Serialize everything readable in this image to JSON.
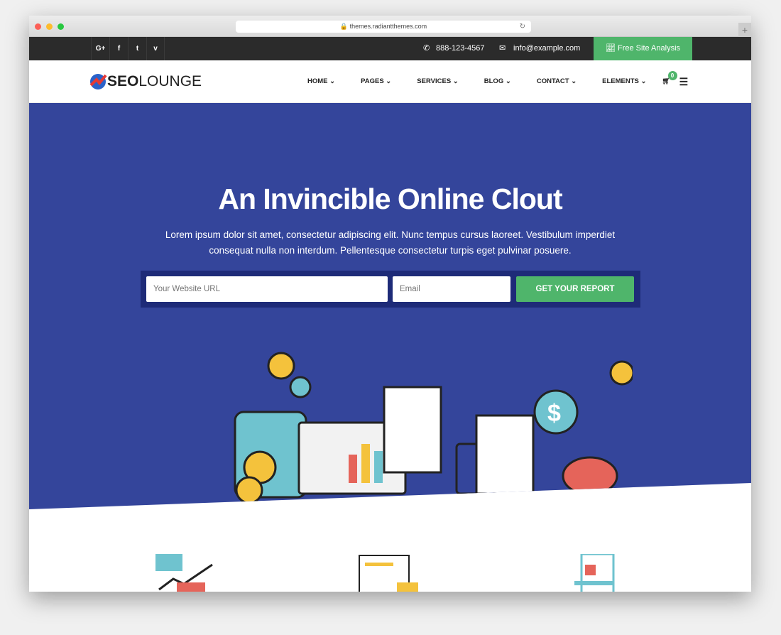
{
  "browser": {
    "url": "themes.radiantthemes.com"
  },
  "topbar": {
    "social": [
      "G+",
      "f",
      "t",
      "v"
    ],
    "phone": "888-123-4567",
    "email": "info@example.com",
    "cta": "Free Site Analysis"
  },
  "nav": {
    "logo_bold": "SEO",
    "logo_light": "LOUNGE",
    "items": [
      "HOME",
      "PAGES",
      "SERVICES",
      "BLOG",
      "CONTACT",
      "ELEMENTS"
    ],
    "cart_count": "0"
  },
  "hero": {
    "title": "An Invincible Online Clout",
    "subtitle": "Lorem ipsum dolor sit amet, consectetur adipiscing elit. Nunc tempus cursus laoreet. Vestibulum imperdiet consequat nulla non interdum. Pellentesque consectetur turpis eget pulvinar posuere.",
    "url_placeholder": "Your Website URL",
    "email_placeholder": "Email",
    "button": "GET YOUR REPORT"
  },
  "colors": {
    "hero": "#34459b",
    "accent": "#4fb56b",
    "topbar": "#2b2b2b"
  }
}
